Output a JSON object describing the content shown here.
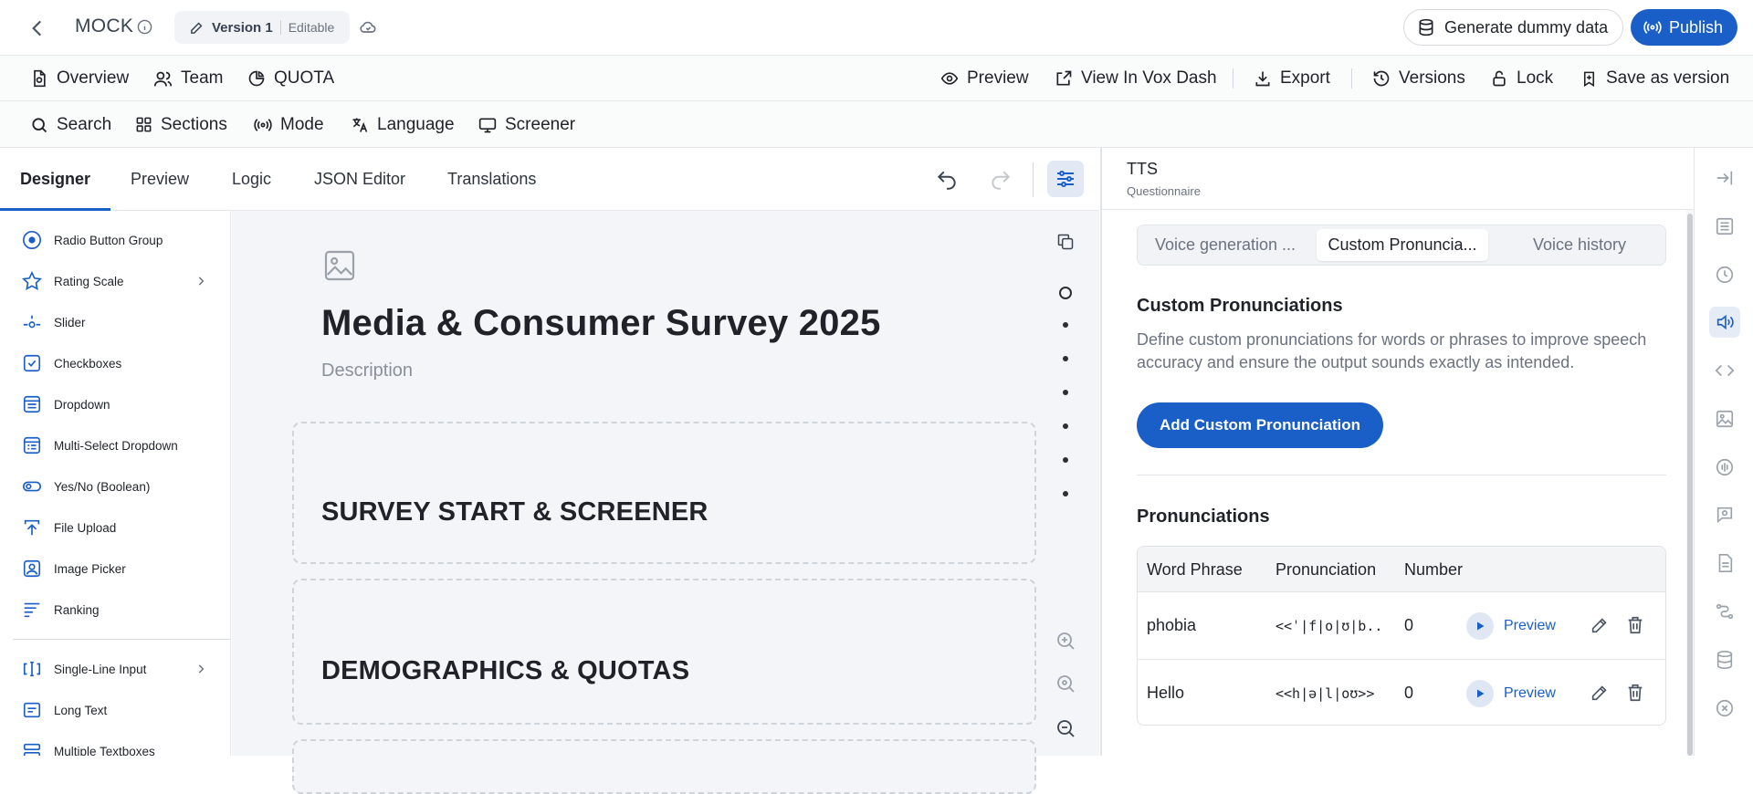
{
  "topbar": {
    "project_name": "MOCK",
    "version_label": "Version 1",
    "version_status": "Editable",
    "generate_label": "Generate dummy data",
    "publish_label": "Publish"
  },
  "nav_primary": {
    "left": [
      "Overview",
      "Team",
      "QUOTA"
    ],
    "right": [
      "Preview",
      "View In Vox Dash",
      "Export",
      "Versions",
      "Lock",
      "Save as version"
    ]
  },
  "nav_secondary": [
    "Search",
    "Sections",
    "Mode",
    "Language",
    "Screener"
  ],
  "editor_tabs": [
    "Designer",
    "Preview",
    "Logic",
    "JSON Editor",
    "Translations"
  ],
  "active_editor_tab": "Designer",
  "toolbox": {
    "items": [
      "Radio Button Group",
      "Rating Scale",
      "Slider",
      "Checkboxes",
      "Dropdown",
      "Multi-Select Dropdown",
      "Yes/No (Boolean)",
      "File Upload",
      "Image Picker",
      "Ranking"
    ],
    "items_after_divider": [
      "Single-Line Input",
      "Long Text",
      "Multiple Textboxes"
    ]
  },
  "survey": {
    "title": "Media & Consumer Survey 2025",
    "description_placeholder": "Description",
    "sections": [
      "SURVEY START & SCREENER",
      "DEMOGRAPHICS & QUOTAS"
    ]
  },
  "right_panel": {
    "title": "TTS",
    "subtitle": "Questionnaire",
    "tabs": [
      "Voice generation ...",
      "Custom Pronuncia...",
      "Voice history"
    ],
    "active_tab": "Custom Pronuncia...",
    "custom_heading": "Custom Pronunciations",
    "custom_description": "Define custom pronunciations for words or phrases to improve speech accuracy and ensure the output sounds exactly as intended.",
    "add_button": "Add Custom Pronunciation",
    "pronunciations_heading": "Pronunciations",
    "table": {
      "columns": [
        "Word Phrase",
        "Pronunciation",
        "Number"
      ],
      "rows": [
        {
          "word": "phobia",
          "pronunciation": "<<ˈ|f|o|ʊ|b...",
          "number": "0",
          "preview": "Preview"
        },
        {
          "word": "Hello",
          "pronunciation": "<<h|ə|l|oʊ>>",
          "number": "0",
          "preview": "Preview"
        }
      ]
    }
  },
  "colors": {
    "accent": "#1a5fc7",
    "canvas_bg": "#f3f5f9",
    "border": "#e5e7eb"
  }
}
